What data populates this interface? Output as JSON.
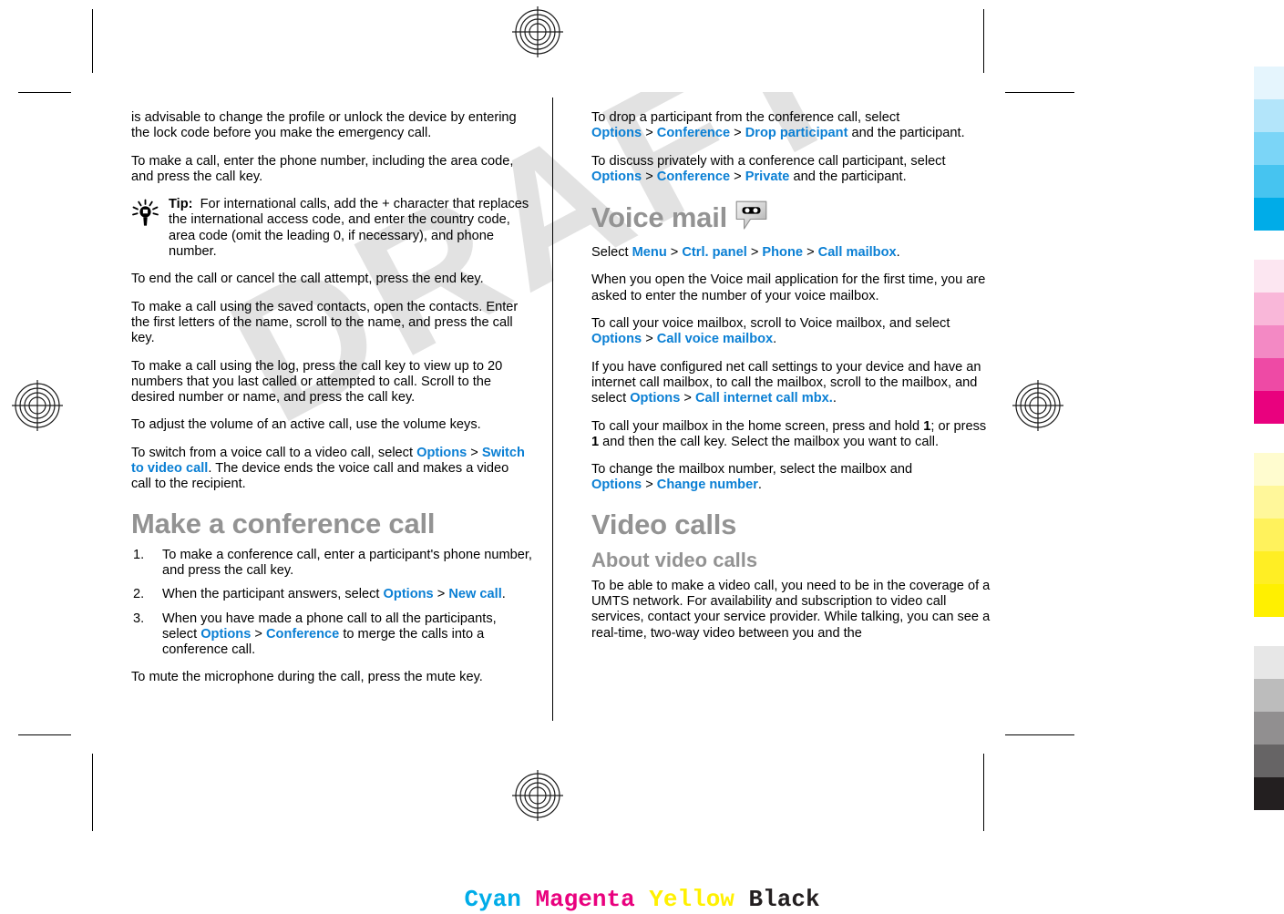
{
  "document": {
    "watermark_text": "DRAFT",
    "watermark_color": "#e2e2e2",
    "link_color": "#0a7fd4",
    "heading_color": "#939393"
  },
  "left_column": {
    "para_1": "is advisable to change the profile or unlock the device by entering the lock code before you make the emergency call.",
    "para_2": "To make a call, enter the phone number, including the area code, and press the call key.",
    "tip": {
      "icon": "lightbulb-icon",
      "label": "Tip:",
      "text": "For international calls, add the + character that replaces the international access code, and enter the country code, area code (omit the leading 0, if necessary), and phone number."
    },
    "para_3": "To end the call or cancel the call attempt, press the end key.",
    "para_4": "To make a call using the saved contacts, open the contacts. Enter the first letters of the name, scroll to the name, and press the call key.",
    "para_5": "To make a call using the log, press the call key to view up to 20 numbers that you last called or attempted to call. Scroll to the desired number or name, and press the call key.",
    "para_6": "To adjust the volume of an active call, use the volume keys.",
    "para_7": {
      "before": "To switch from a voice call to a video call, select ",
      "ui_1": "Options",
      "sep": ">",
      "ui_2": "Switch to video call",
      "after": ". The device ends the voice call and makes a video call to the recipient."
    },
    "heading_conference": "Make a conference call",
    "steps": [
      {
        "before": "To make a conference call, enter a participant's phone number, and press the call key.",
        "ui_1": "",
        "sep": "",
        "ui_2": "",
        "after": ""
      },
      {
        "before": "When the participant answers, select ",
        "ui_1": "Options",
        "sep": ">",
        "ui_2": "New call",
        "after": "."
      },
      {
        "before": "When you have made a phone call to all the participants, select ",
        "ui_1": "Options",
        "sep": ">",
        "ui_2": "Conference",
        "after": " to merge the calls into a conference call."
      }
    ],
    "para_8": "To mute the microphone during the call, press the mute key."
  },
  "right_column": {
    "para_1": {
      "before": "To drop a participant from the conference call, select ",
      "ui_1": "Options",
      "sep_1": ">",
      "ui_2": "Conference",
      "sep_2": ">",
      "ui_3": "Drop participant",
      "after": " and the participant."
    },
    "para_2": {
      "before": "To discuss privately with a conference call participant, select ",
      "ui_1": "Options",
      "sep_1": ">",
      "ui_2": "Conference",
      "sep_2": ">",
      "ui_3": "Private",
      "after": " and the participant."
    },
    "heading_voicemail": "Voice mail",
    "voicemail_icon": "voicemail-bubble-icon",
    "para_3": {
      "before": "Select ",
      "ui_1": "Menu",
      "sep_1": ">",
      "ui_2": "Ctrl. panel",
      "sep_2": ">",
      "ui_3": "Phone",
      "sep_3": ">",
      "ui_4": "Call mailbox",
      "after": "."
    },
    "para_4": "When you open the Voice mail application for the first time, you are asked to enter the number of your voice mailbox.",
    "para_5": {
      "before": "To call your voice mailbox, scroll to Voice mailbox, and select ",
      "ui_1": "Options",
      "sep_1": ">",
      "ui_2": "Call voice mailbox",
      "after": "."
    },
    "para_6": {
      "before": "If you have configured net call settings to your device and have an internet call mailbox, to call the mailbox, scroll to the mailbox, and select ",
      "ui_1": "Options",
      "sep_1": ">",
      "ui_2": "Call internet call mbx.",
      "after": "."
    },
    "para_7": {
      "before": "To call your mailbox in the home screen, press and hold ",
      "bold_1": "1",
      "middle": "; or press ",
      "bold_2": "1",
      "after": " and then the call key. Select the mailbox you want to call."
    },
    "para_8": {
      "before": "To change the mailbox number, select the mailbox and ",
      "ui_1": "Options",
      "sep_1": ">",
      "ui_2": "Change number",
      "after": "."
    },
    "heading_videocalls": "Video calls",
    "heading_about": "About video calls",
    "para_9": "To be able to make a video call, you need to be in the coverage of a UMTS network. For availability and subscription to video call services, contact your service provider. While talking, you can see a real-time, two-way video between you and the"
  },
  "color_bar": {
    "cyan": [
      "#e5f5fd",
      "#b3e5fa",
      "#7bd5f7",
      "#46c4f0",
      "#00ace8"
    ],
    "magenta": [
      "#fce6f1",
      "#f9b7d9",
      "#f389c4",
      "#ee4aa5",
      "#e9017e"
    ],
    "yellow": [
      "#fffccf",
      "#fff79a",
      "#fff25c",
      "#ffee24",
      "#fff000"
    ],
    "black": [
      "#e7e7e7",
      "#bcbcbc",
      "#918f90",
      "#666465",
      "#231f20"
    ]
  },
  "cmyk_caption": {
    "cyan": "Cyan",
    "magenta": "Magenta",
    "yellow": "Yellow",
    "black": "Black",
    "cyan_color": "#00ace8",
    "magenta_color": "#e9017e",
    "yellow_color": "#fff000",
    "black_color": "#231f20"
  }
}
